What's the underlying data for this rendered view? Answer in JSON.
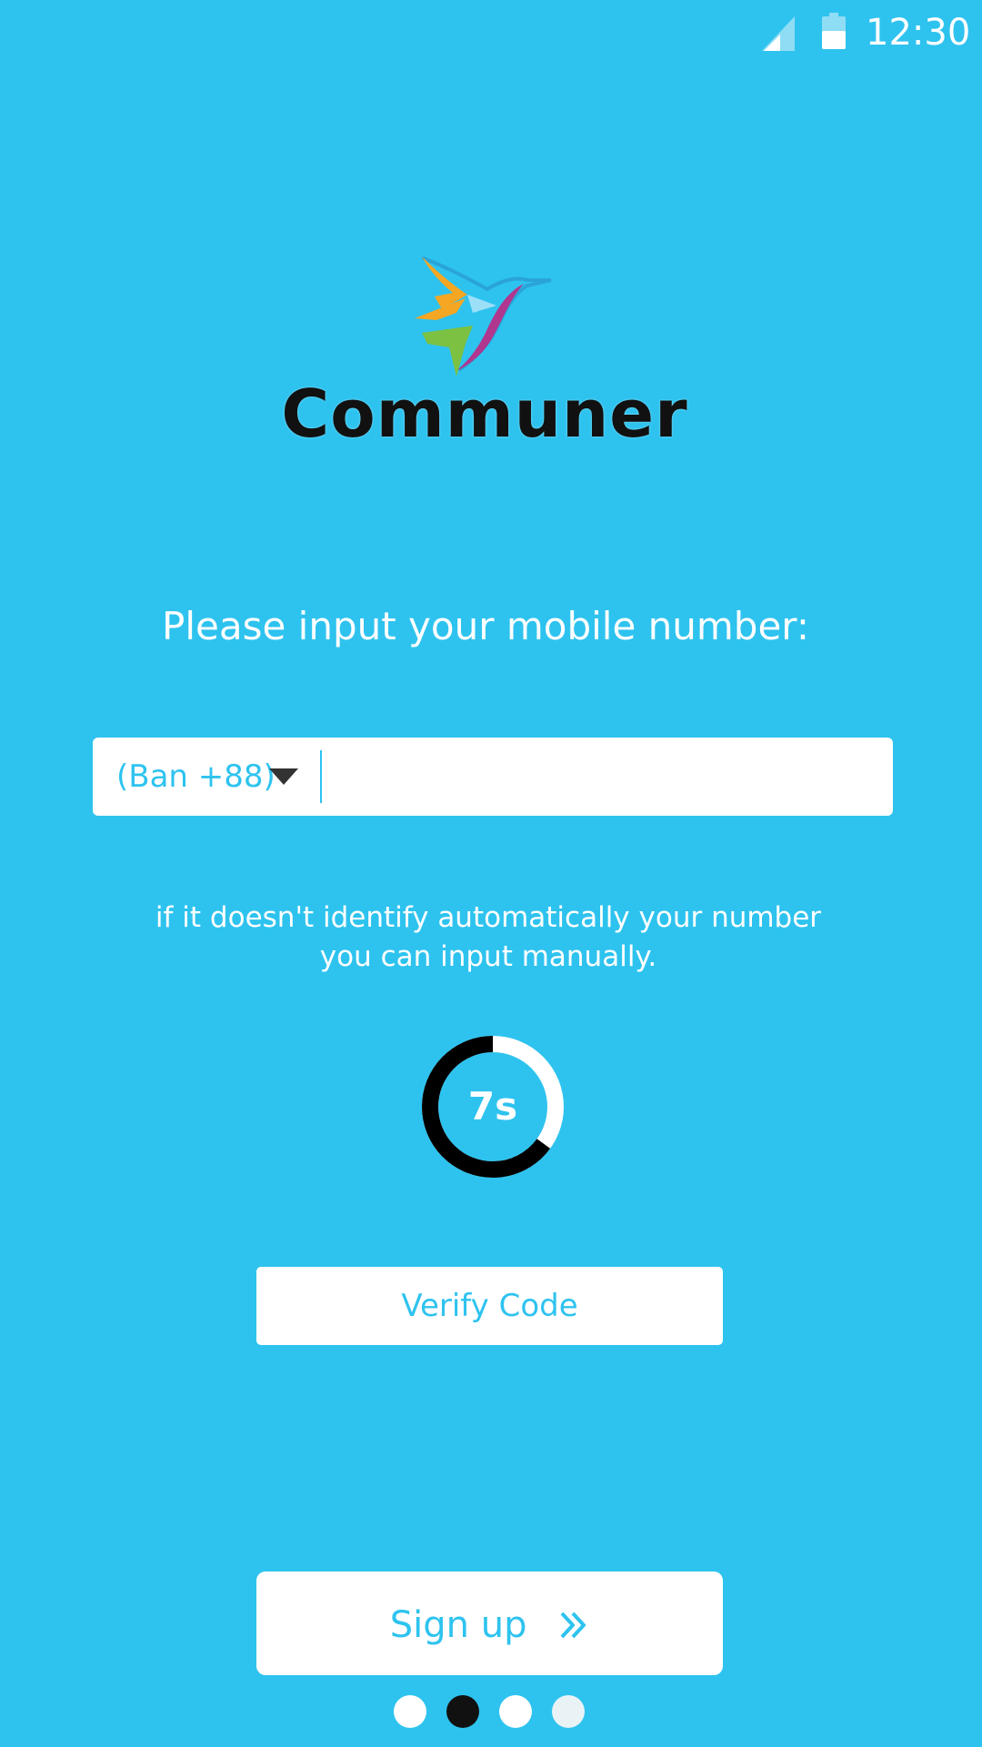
{
  "status_bar": {
    "time": "12:30",
    "icons": [
      "signal-icon",
      "battery-icon"
    ]
  },
  "brand": {
    "name": "Communer",
    "logo_icon": "hummingbird-logo-icon"
  },
  "form": {
    "prompt": "Please input your mobile number:",
    "country_code": "(Ban +88)",
    "phone_value": "",
    "phone_placeholder": "",
    "hint_line1": "if it doesn't identify automatically your number",
    "hint_line2": "you can input manually."
  },
  "timer": {
    "label": "7s",
    "remaining_fraction": 0.65
  },
  "buttons": {
    "verify_label": "Verify Code",
    "signup_label": "Sign up",
    "signup_icon": "double-chevron-right-icon"
  },
  "pager": {
    "count": 4,
    "active_index": 1
  },
  "colors": {
    "background": "#2ec3ef",
    "accent": "#2ec3ef",
    "surface": "#ffffff",
    "dark": "#111111"
  }
}
